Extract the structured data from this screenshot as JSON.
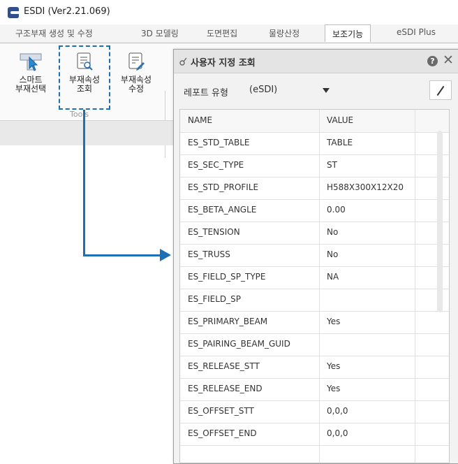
{
  "window": {
    "title": "ESDI (Ver2.21.069)"
  },
  "menu": {
    "tabs": [
      {
        "label": "구조부재 생성 및 수정",
        "active": false
      },
      {
        "label": "3D 모델링",
        "active": false
      },
      {
        "label": "도면편집",
        "active": false
      },
      {
        "label": "물량산정",
        "active": false
      },
      {
        "label": "보조기능",
        "active": true
      },
      {
        "label": "eSDI Plus",
        "active": false
      }
    ]
  },
  "ribbon": {
    "buttons": [
      {
        "label": "스마트\n부재선택",
        "icon": "smart-select-icon"
      },
      {
        "label": "부재속성\n조회",
        "icon": "member-property-view-icon"
      },
      {
        "label": "부재속성\n수정",
        "icon": "member-property-edit-icon"
      }
    ],
    "group_label": "Tools"
  },
  "panel": {
    "title": "사용자 지정 조회",
    "help": "?",
    "close": "✕",
    "report_label": "레포트 유형",
    "report_value": "(eSDI)",
    "columns": [
      "NAME",
      "VALUE"
    ],
    "rows": [
      {
        "name": "ES_STD_TABLE",
        "value": "TABLE"
      },
      {
        "name": "ES_SEC_TYPE",
        "value": "ST"
      },
      {
        "name": "ES_STD_PROFILE",
        "value": "H588X300X12X20"
      },
      {
        "name": "ES_BETA_ANGLE",
        "value": "0.00"
      },
      {
        "name": "ES_TENSION",
        "value": "No"
      },
      {
        "name": "ES_TRUSS",
        "value": "No"
      },
      {
        "name": "ES_FIELD_SP_TYPE",
        "value": "NA"
      },
      {
        "name": "ES_FIELD_SP",
        "value": ""
      },
      {
        "name": "ES_PRIMARY_BEAM",
        "value": "Yes"
      },
      {
        "name": "ES_PAIRING_BEAM_GUID",
        "value": ""
      },
      {
        "name": "ES_RELEASE_STT",
        "value": "Yes"
      },
      {
        "name": "ES_RELEASE_END",
        "value": "Yes"
      },
      {
        "name": "ES_OFFSET_STT",
        "value": "0,0,0"
      },
      {
        "name": "ES_OFFSET_END",
        "value": "0,0,0"
      }
    ]
  },
  "colors": {
    "accent": "#1f6fb5",
    "app_icon": "#2f4f8f"
  }
}
